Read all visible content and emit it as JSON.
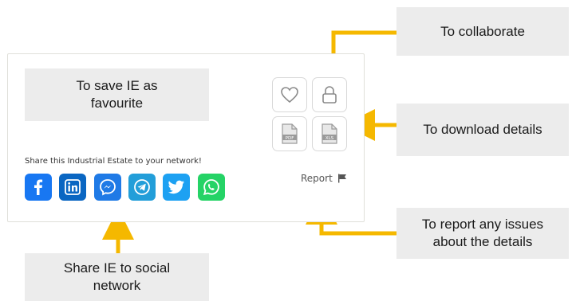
{
  "callouts": {
    "collaborate": "To collaborate",
    "favourite": "To save IE as\nfavourite",
    "download": "To download details",
    "report": "To report any issues\nabout the details",
    "share": "Share IE to social\nnetwork"
  },
  "card": {
    "share_text": "Share this Industrial Estate to your network!",
    "report_label": "Report",
    "pdf_label": "PDF",
    "xls_label": "XLS"
  },
  "social": [
    {
      "name": "facebook",
      "color": "#1877f2"
    },
    {
      "name": "linkedin",
      "color": "#0a66c2"
    },
    {
      "name": "messenger",
      "color": "#1f7ae6"
    },
    {
      "name": "telegram",
      "color": "#229ed9"
    },
    {
      "name": "twitter",
      "color": "#1da1f2"
    },
    {
      "name": "whatsapp",
      "color": "#25d366"
    }
  ],
  "colors": {
    "arrow": "#f5b800",
    "callout_bg": "#ececec"
  }
}
